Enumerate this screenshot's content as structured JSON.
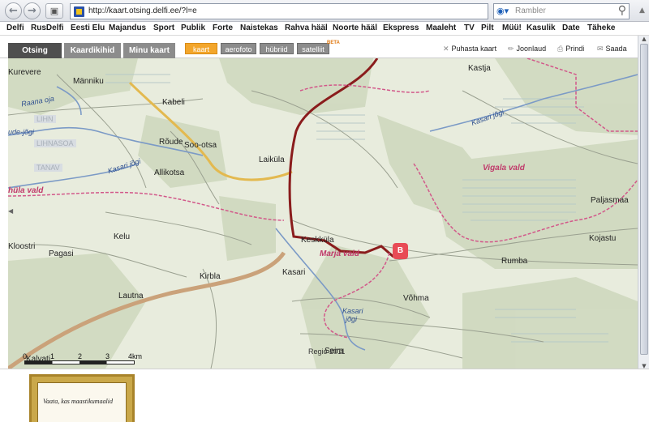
{
  "browser": {
    "url": "http://kaart.otsing.delfi.ee/?l=e",
    "search_placeholder": "Rambler"
  },
  "portal_links": [
    "Delfi",
    "RusDelfi",
    "Eesti Elu",
    "Majandus",
    "Sport",
    "Publik",
    "Forte",
    "Naistekas",
    "Rahva hääl",
    "Noorte hääl",
    "Ekspress",
    "Maaleht",
    "TV",
    "Pilt",
    "Müü!",
    "Kasulik",
    "Date",
    "Täheke"
  ],
  "panel_tabs": [
    "Otsing",
    "Kaardikihid",
    "Minu kaart"
  ],
  "map_types": [
    "kaart",
    "aerofoto",
    "hübriid",
    "satelliit"
  ],
  "beta_label": "BETA",
  "tools": {
    "clear": "Puhasta kaart",
    "ruler": "Joonlaud",
    "print": "Prindi",
    "send": "Saada"
  },
  "map": {
    "places": {
      "kurevere": "Kurevere",
      "manniku": "Männiku",
      "kabeli": "Kabeli",
      "roude": "Rõude",
      "soo_otsa": "Soo-otsa",
      "laikula": "Laiküla",
      "allikotsa": "Allikotsa",
      "kelu": "Kelu",
      "pagasi": "Pagasi",
      "kloostri": "Kloostri",
      "kirbla": "Kirbla",
      "lautna": "Lautna",
      "keskkula": "Keskküla",
      "kasari": "Kasari",
      "vohma": "Võhma",
      "seira": "Seira",
      "kalvati": "Kalvati",
      "kastja": "Kastja",
      "paljasmaa": "Paljasmaa",
      "kojastu": "Kojastu",
      "rumba": "Rumba"
    },
    "water": {
      "raana_oja": "Raana oja",
      "ude_jogi": "ude-jõgi",
      "kasari_jogi_w": "Kasari jõgi",
      "kasari_jogi_ne": "Kasari jõgi",
      "kasari_jogi_s1": "Kasari",
      "kasari_jogi_s2": "jõgi"
    },
    "districts": {
      "hula": "hüla vald",
      "vigala": "Vigala vald",
      "marja": "Marja vald"
    },
    "faded_labels": [
      "LIHN",
      "LIHNASOA",
      "TANAV"
    ],
    "marker": "B",
    "scale_labels": [
      "0",
      "1",
      "2",
      "3",
      "4km"
    ],
    "copyright": "Regio 2011"
  },
  "ad": {
    "text": "Vaata, kas maastikumaalid"
  }
}
